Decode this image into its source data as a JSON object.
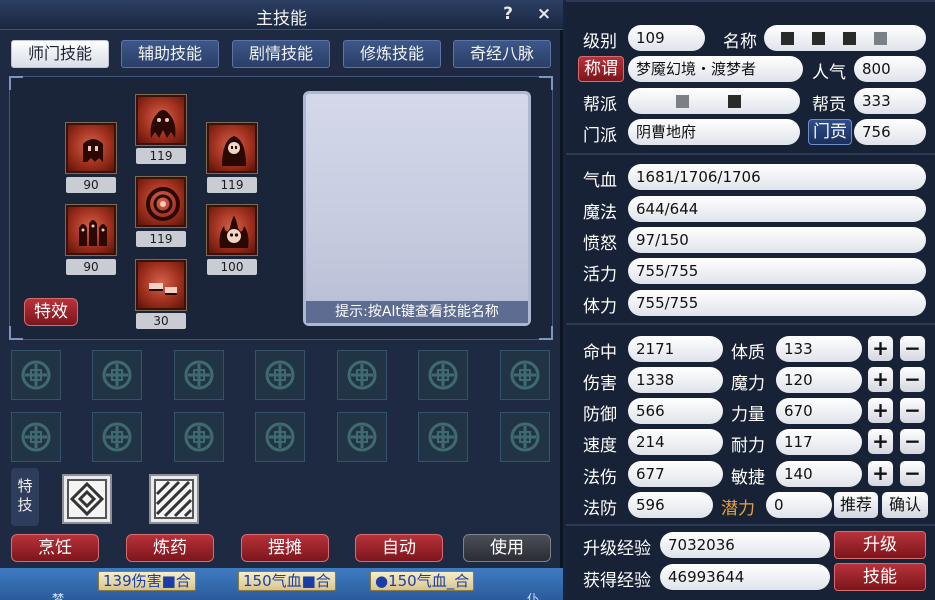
{
  "skill_window": {
    "title": "主技能",
    "help_icon": "?",
    "close_icon": "×",
    "tabs": [
      {
        "label": "师门技能",
        "active": true
      },
      {
        "label": "辅助技能",
        "active": false
      },
      {
        "label": "剧情技能",
        "active": false
      },
      {
        "label": "修炼技能",
        "active": false
      },
      {
        "label": "奇经八脉",
        "active": false
      }
    ],
    "skills": [
      {
        "icon": "ghost-hands-icon",
        "level": "90"
      },
      {
        "icon": "ghost-trio-icon",
        "level": "90"
      },
      {
        "icon": "ghost-flame-icon",
        "level": "119"
      },
      {
        "icon": "ring-seal-icon",
        "level": "119"
      },
      {
        "icon": "shoe-icon",
        "level": "30"
      },
      {
        "icon": "hooded-reaper-icon",
        "level": "119"
      },
      {
        "icon": "skull-fire-icon",
        "level": "100"
      }
    ],
    "effects_button": "特效",
    "hint": "提示:按Alt键查看技能名称",
    "special_label": "特技",
    "special_icons": [
      "diamond-pattern-icon",
      "stripes-pattern-icon"
    ],
    "actions": [
      "烹饪",
      "炼药",
      "摆摊",
      "自动",
      "使用"
    ],
    "chat_chips": [
      "139伤害■合",
      "150气血■合",
      "●150气血_合"
    ],
    "chat_fragments": [
      "梦",
      "仆"
    ]
  },
  "attributes": {
    "level_label": "级别",
    "level": "109",
    "name_label": "名称",
    "title_button": "称谓",
    "title_value": "梦魇幻境・渡梦者",
    "popularity_label": "人气",
    "popularity": "800",
    "gang_label": "帮派",
    "contribution_label": "帮贡",
    "contribution": "333",
    "school_label": "门派",
    "school": "阴曹地府",
    "school_contrib_button": "门贡",
    "school_contrib": "756",
    "hp_label": "气血",
    "hp": "1681/1706/1706",
    "mp_label": "魔法",
    "mp": "644/644",
    "rage_label": "愤怒",
    "rage": "97/150",
    "vitality_label": "活力",
    "vitality": "755/755",
    "stamina_label": "体力",
    "stamina": "755/755",
    "stats": [
      {
        "label": "命中",
        "value": "2171"
      },
      {
        "label": "伤害",
        "value": "1338"
      },
      {
        "label": "防御",
        "value": "566"
      },
      {
        "label": "速度",
        "value": "214"
      },
      {
        "label": "法伤",
        "value": "677"
      },
      {
        "label": "法防",
        "value": "596"
      }
    ],
    "points": [
      {
        "label": "体质",
        "value": "133"
      },
      {
        "label": "魔力",
        "value": "120"
      },
      {
        "label": "力量",
        "value": "670"
      },
      {
        "label": "耐力",
        "value": "117"
      },
      {
        "label": "敏捷",
        "value": "140"
      }
    ],
    "potential_label": "潜力",
    "potential": "0",
    "recommend_button": "推荐",
    "confirm_button": "确认",
    "plus_glyph": "+",
    "minus_glyph": "−",
    "upgrade_exp_label": "升级经验",
    "upgrade_exp": "7032036",
    "upgrade_button": "升级",
    "gained_exp_label": "获得经验",
    "gained_exp": "46993644",
    "skills_button": "技能",
    "colors": {
      "potential_label": "#e8a23a",
      "red_button": "#9a222a",
      "panel_bg": "#182236"
    }
  }
}
